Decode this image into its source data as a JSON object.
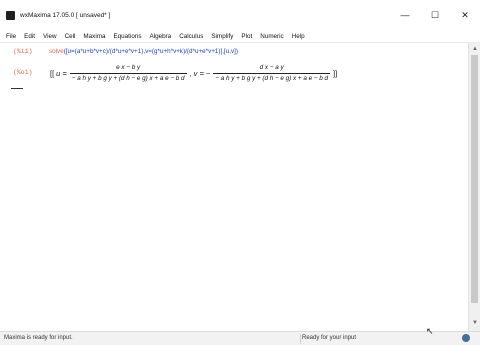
{
  "window": {
    "title": "wxMaxima 17.05.0 [ unsaved* ]",
    "minimize": "—",
    "maximize": "☐",
    "close": "✕"
  },
  "menu": [
    "File",
    "Edit",
    "View",
    "Cell",
    "Maxima",
    "Equations",
    "Algebra",
    "Calculus",
    "Simplify",
    "Plot",
    "Numeric",
    "Help"
  ],
  "cells": {
    "input_label": "(%i1)",
    "input_fn": "solve",
    "input_args": "([u=(a*u+b*v+c)/(d*u+e*v+1),v=(g*u+h*v+k)/(d*u+e*v+1)],[u,v])",
    "output_label": "(%o1)",
    "output": {
      "open": "[[",
      "u_lhs": "u =",
      "u_num": "e x − b y",
      "u_den": "− a h y + b g y + (d h − e g) x + a e − b d",
      "sep": ",",
      "v_lhs": "v = −",
      "v_num": "d x − a y",
      "v_den": "− a h y + b g y + (d h − e g) x + a e − b d",
      "close": "]]"
    }
  },
  "status": {
    "left": "Maxima is ready for input.",
    "right": "Ready for your input"
  }
}
